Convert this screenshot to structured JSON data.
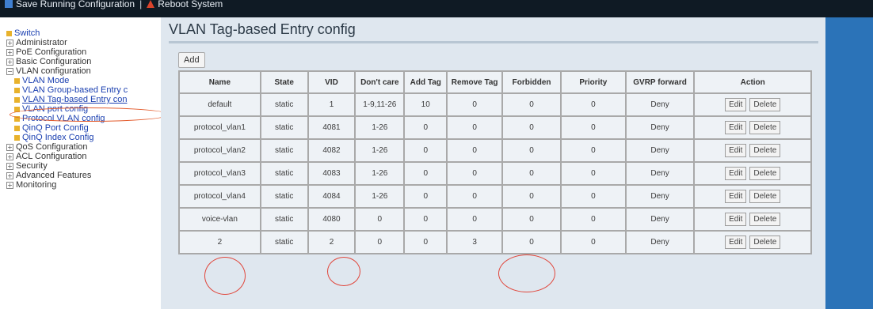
{
  "topbar": {
    "tabs": [
      {
        "label": "Save Running Configuration",
        "icon": "save-icon"
      },
      {
        "label": "Reboot System",
        "icon": "reboot-icon"
      }
    ]
  },
  "sidebar": {
    "items": [
      {
        "label": "Switch",
        "kind": "leaf-top"
      },
      {
        "label": "Administrator",
        "kind": "folder"
      },
      {
        "label": "PoE Configuration",
        "kind": "folder"
      },
      {
        "label": "Basic Configuration",
        "kind": "folder"
      },
      {
        "label": "VLAN configuration",
        "kind": "folder-open"
      },
      {
        "label": "VLAN Mode",
        "kind": "child"
      },
      {
        "label": "VLAN Group-based Entry c",
        "kind": "child"
      },
      {
        "label": "VLAN Tag-based Entry con",
        "kind": "child-active"
      },
      {
        "label": "VLAN port config",
        "kind": "child"
      },
      {
        "label": "Protocol VLAN config",
        "kind": "child"
      },
      {
        "label": "QinQ Port Config",
        "kind": "child"
      },
      {
        "label": "QinQ Index Config",
        "kind": "child"
      },
      {
        "label": "QoS Configuration",
        "kind": "folder"
      },
      {
        "label": "ACL Configuration",
        "kind": "folder"
      },
      {
        "label": "Security",
        "kind": "folder"
      },
      {
        "label": "Advanced Features",
        "kind": "folder"
      },
      {
        "label": "Monitoring",
        "kind": "folder"
      }
    ]
  },
  "main": {
    "title": "VLAN Tag-based Entry config",
    "add_label": "Add",
    "columns": [
      "Name",
      "State",
      "VID",
      "Don't care",
      "Add Tag",
      "Remove Tag",
      "Forbidden",
      "Priority",
      "GVRP forward",
      "Action"
    ],
    "edit_label": "Edit",
    "delete_label": "Delete",
    "rows": [
      {
        "name": "default",
        "state": "static",
        "vid": "1",
        "dont_care": "1-9,11-26",
        "add_tag": "10",
        "remove_tag": "0",
        "forbidden": "0",
        "priority": "0",
        "gvrp": "Deny"
      },
      {
        "name": "protocol_vlan1",
        "state": "static",
        "vid": "4081",
        "dont_care": "1-26",
        "add_tag": "0",
        "remove_tag": "0",
        "forbidden": "0",
        "priority": "0",
        "gvrp": "Deny"
      },
      {
        "name": "protocol_vlan2",
        "state": "static",
        "vid": "4082",
        "dont_care": "1-26",
        "add_tag": "0",
        "remove_tag": "0",
        "forbidden": "0",
        "priority": "0",
        "gvrp": "Deny"
      },
      {
        "name": "protocol_vlan3",
        "state": "static",
        "vid": "4083",
        "dont_care": "1-26",
        "add_tag": "0",
        "remove_tag": "0",
        "forbidden": "0",
        "priority": "0",
        "gvrp": "Deny"
      },
      {
        "name": "protocol_vlan4",
        "state": "static",
        "vid": "4084",
        "dont_care": "1-26",
        "add_tag": "0",
        "remove_tag": "0",
        "forbidden": "0",
        "priority": "0",
        "gvrp": "Deny"
      },
      {
        "name": "voice-vlan",
        "state": "static",
        "vid": "4080",
        "dont_care": "0",
        "add_tag": "0",
        "remove_tag": "0",
        "forbidden": "0",
        "priority": "0",
        "gvrp": "Deny"
      },
      {
        "name": "2",
        "state": "static",
        "vid": "2",
        "dont_care": "0",
        "add_tag": "0",
        "remove_tag": "3",
        "forbidden": "0",
        "priority": "0",
        "gvrp": "Deny"
      }
    ]
  },
  "colors": {
    "page_bg": "#2b73b8",
    "topbar_bg": "#0f1a24",
    "content_bg": "#dfe7ef",
    "table_bg": "#eef2f6",
    "annotation_red": "#e0463b",
    "annotation_orange": "#e35a2b",
    "tree_bullet": "#e8b22c"
  }
}
